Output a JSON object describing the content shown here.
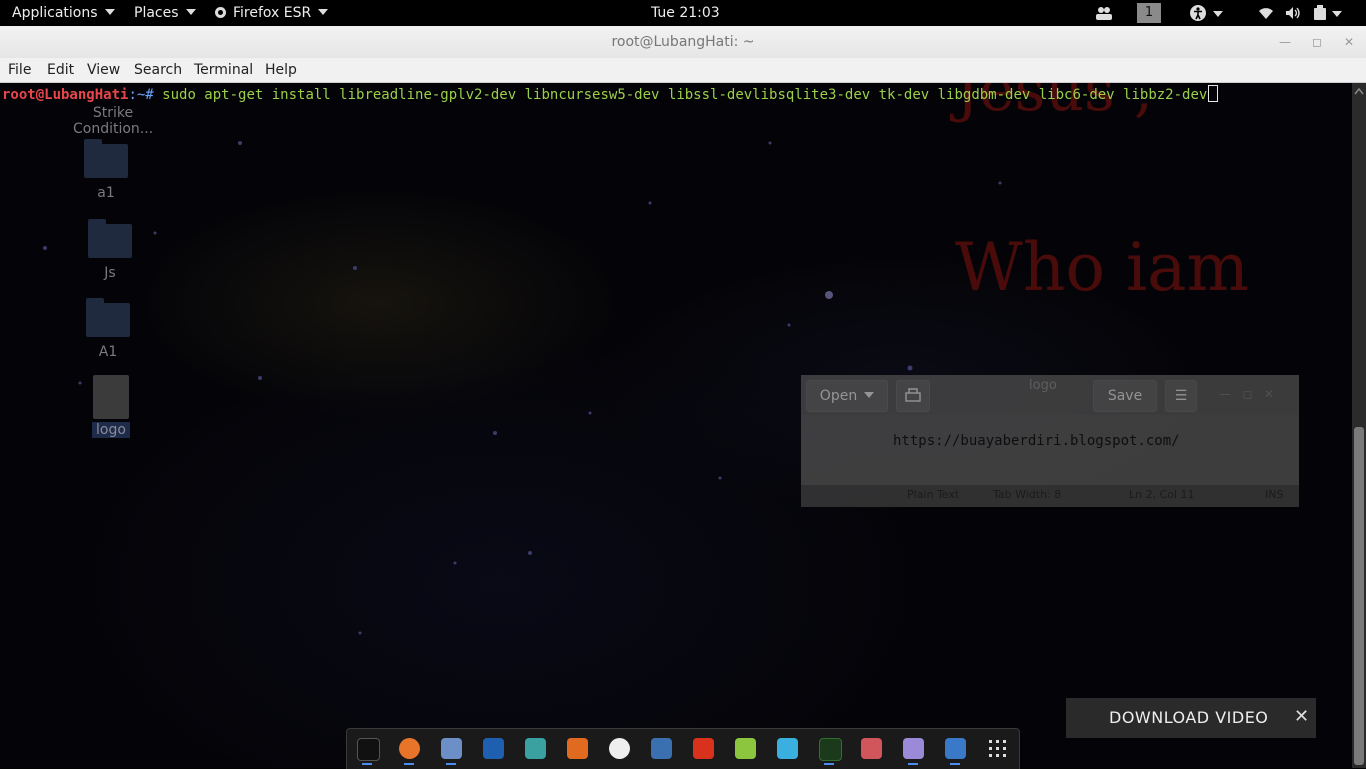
{
  "topbar": {
    "applications": "Applications",
    "places": "Places",
    "firefox": "Firefox ESR",
    "clock": "Tue 21:03",
    "workspace": "1"
  },
  "window": {
    "title": "root@LubangHati: ~",
    "menu": [
      "File",
      "Edit",
      "View",
      "Search",
      "Terminal",
      "Help"
    ]
  },
  "terminal": {
    "prompt_user": "root@LubangHati",
    "prompt_sep": ":~#",
    "command": " sudo apt-get install libreadline-gplv2-dev libncursesw5-dev libssl-devlibsqlite3-dev tk-dev libgdbm-dev libc6-dev libbz2-dev"
  },
  "desktop": {
    "icons": [
      "Strike Condition...",
      "a1",
      "Js",
      "A1",
      "logo"
    ],
    "wallpaper_text_1": "Jesus ,",
    "wallpaper_text_2": "Who iam"
  },
  "editor": {
    "open": "Open",
    "title": "logo",
    "save": "Save",
    "content": "https://buayaberdiri.blogspot.com/",
    "status_lang": "Plain Text",
    "status_tab": "Tab Width: 8",
    "status_pos": "Ln 2, Col 11",
    "status_mode": "INS"
  },
  "download_bar": {
    "label": "DOWNLOAD VIDEO",
    "close": "✕"
  },
  "dock": {
    "apps": [
      "terminal-icon",
      "firefox-icon",
      "files-icon",
      "metasploit-icon",
      "armitage-icon",
      "burpsuite-icon",
      "maltego-icon",
      "beef-icon",
      "faraday-icon",
      "leafpad-icon",
      "wireshark-icon",
      "system-monitor-icon",
      "cherrytree-icon",
      "text-editor-icon",
      "toolbox-icon",
      "show-apps-icon"
    ]
  },
  "colors": {
    "prompt": "#e8464b",
    "command": "#9bd04a",
    "accent": "#4a8cf0"
  }
}
